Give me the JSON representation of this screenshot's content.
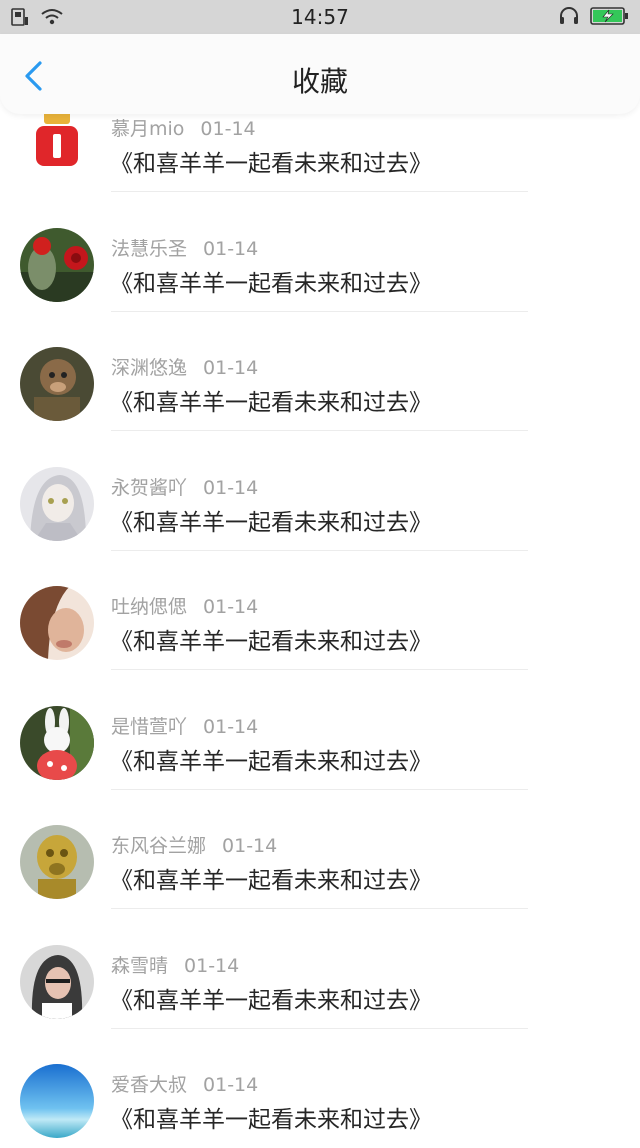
{
  "status_bar": {
    "time": "14:57",
    "icons": [
      "sim-icon",
      "wifi-icon",
      "headphones-icon",
      "battery-charging-icon"
    ]
  },
  "header": {
    "title": "收藏",
    "back_icon": "chevron-left-icon",
    "accent_color": "#2a9af0"
  },
  "favorites": [
    {
      "name": "慕月mio",
      "date": "01-14",
      "text": "《和喜羊羊一起看未来和过去》",
      "avatar": "red-cartoon-avatar"
    },
    {
      "name": "法慧乐圣",
      "date": "01-14",
      "text": "《和喜羊羊一起看未来和过去》",
      "avatar": "cactus-flower-avatar"
    },
    {
      "name": "深渊悠逸",
      "date": "01-14",
      "text": "《和喜羊羊一起看未来和过去》",
      "avatar": "monkey-avatar"
    },
    {
      "name": "永贺酱吖",
      "date": "01-14",
      "text": "《和喜羊羊一起看未来和过去》",
      "avatar": "anime-girl-avatar"
    },
    {
      "name": "吐纳偲偲",
      "date": "01-14",
      "text": "《和喜羊羊一起看未来和过去》",
      "avatar": "woman-portrait-avatar"
    },
    {
      "name": "是惜萱吖",
      "date": "01-14",
      "text": "《和喜羊羊一起看未来和过去》",
      "avatar": "bunny-toy-avatar"
    },
    {
      "name": "东风谷兰娜",
      "date": "01-14",
      "text": "《和喜羊羊一起看未来和过去》",
      "avatar": "monkey-figurine-avatar"
    },
    {
      "name": "森雪晴",
      "date": "01-14",
      "text": "《和喜羊羊一起看未来和过去》",
      "avatar": "hooded-girl-avatar"
    },
    {
      "name": "爱香大叔",
      "date": "01-14",
      "text": "《和喜羊羊一起看未来和过去》",
      "avatar": "ocean-sky-avatar"
    }
  ]
}
